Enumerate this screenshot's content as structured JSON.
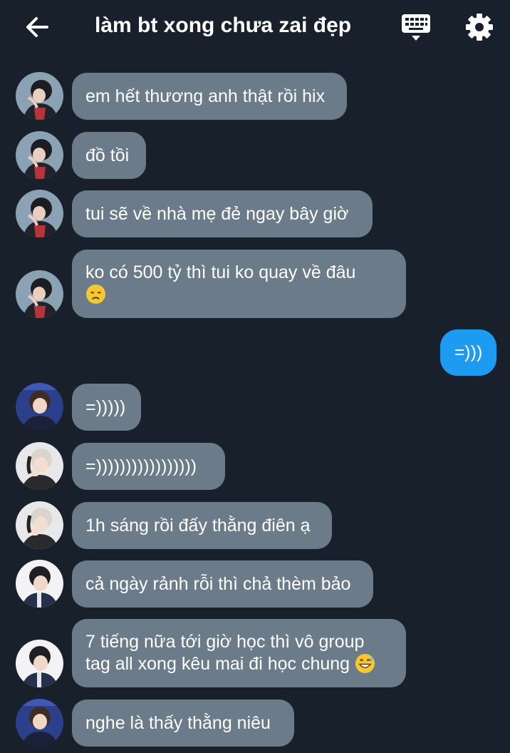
{
  "header": {
    "title": "làm bt xong chưa zai đẹp",
    "back_icon": "arrow-left-icon",
    "keyboard_icon": "keyboard-icon",
    "settings_icon": "gear-icon"
  },
  "messages": [
    {
      "text": "em hết thương anh thật rồi hix"
    },
    {
      "text": "đồ tồi"
    },
    {
      "text": "tui sẽ về nhà mẹ đẻ ngay bây giờ"
    },
    {
      "text": "ko có 500 tỷ thì tui ko quay về đâu",
      "emoji": "disappointed-face-emoji"
    },
    {
      "text": "=)))",
      "outgoing": true
    },
    {
      "text": "=)))))"
    },
    {
      "text": "=)))))))))))))))))"
    },
    {
      "text": "1h sáng rồi đấy thằng điên ạ"
    },
    {
      "text": "cả ngày rảnh rỗi thì chả thèm bảo"
    },
    {
      "line1": "7 tiếng nữa tới giờ học thì vô group",
      "line2": "tag all xong kêu mai đi học chung",
      "emoji": "grinning-sweat-emoji"
    },
    {
      "text": "nghe là thấy thằng niêu"
    }
  ],
  "colors": {
    "background": "#17202b",
    "incoming_bubble": "#6c7b8a",
    "outgoing_bubble": "#1d9bf0"
  }
}
